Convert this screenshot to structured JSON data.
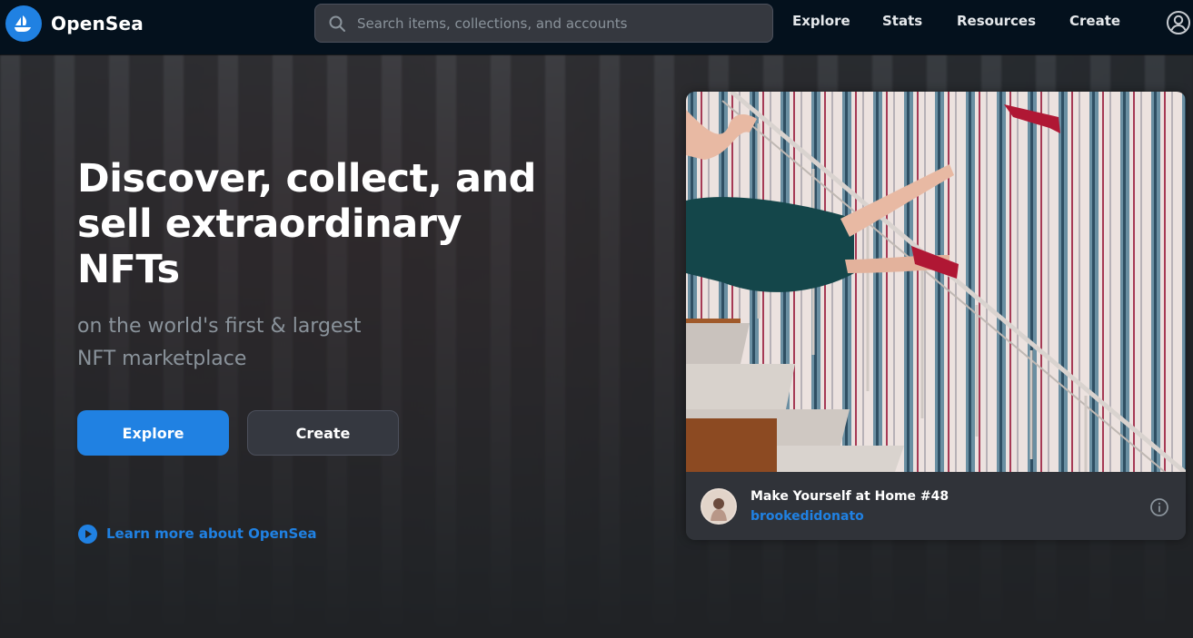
{
  "brand": {
    "name": "OpenSea",
    "color": "#2081e2"
  },
  "search": {
    "placeholder": "Search items, collections, and accounts"
  },
  "nav": {
    "explore": "Explore",
    "stats": "Stats",
    "resources": "Resources",
    "create": "Create"
  },
  "hero": {
    "title": "Discover, collect, and sell extraordinary NFTs",
    "subtitle": "on the world's first & largest NFT marketplace",
    "explore_button": "Explore",
    "create_button": "Create",
    "learn_more": "Learn more about OpenSea"
  },
  "featured": {
    "title": "Make Yourself at Home #48",
    "creator": "brookedidonato"
  },
  "icons": {
    "logo": "opensea-boat-icon",
    "search": "search-icon",
    "account": "account-circle-icon",
    "learn_more": "play-circle-icon",
    "info": "info-icon"
  }
}
